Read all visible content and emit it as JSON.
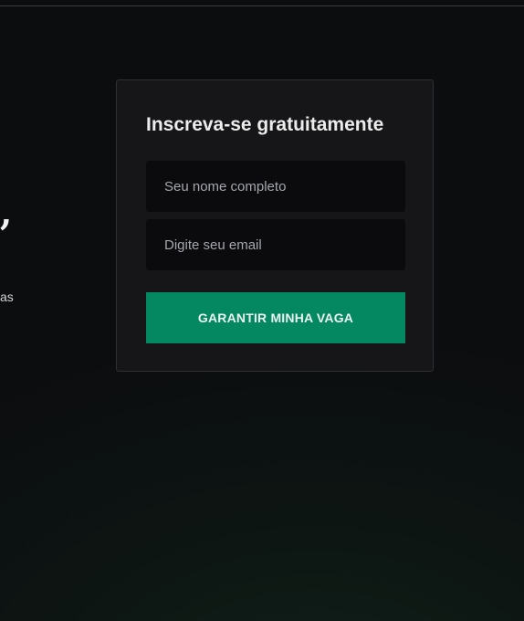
{
  "left_panel": {
    "headline_fragment": ",",
    "text_fragment": "as"
  },
  "signup_form": {
    "title": "Inscreva-se gratuitamente",
    "name_field": {
      "value": "",
      "placeholder": "Seu nome completo"
    },
    "email_field": {
      "value": "",
      "placeholder": "Digite seu email"
    },
    "submit_label": "GARANTIR MINHA VAGA"
  },
  "colors": {
    "background": "#0c0d0f",
    "card_background": "#161618",
    "input_background": "#0b0b0d",
    "accent": "#048862"
  }
}
